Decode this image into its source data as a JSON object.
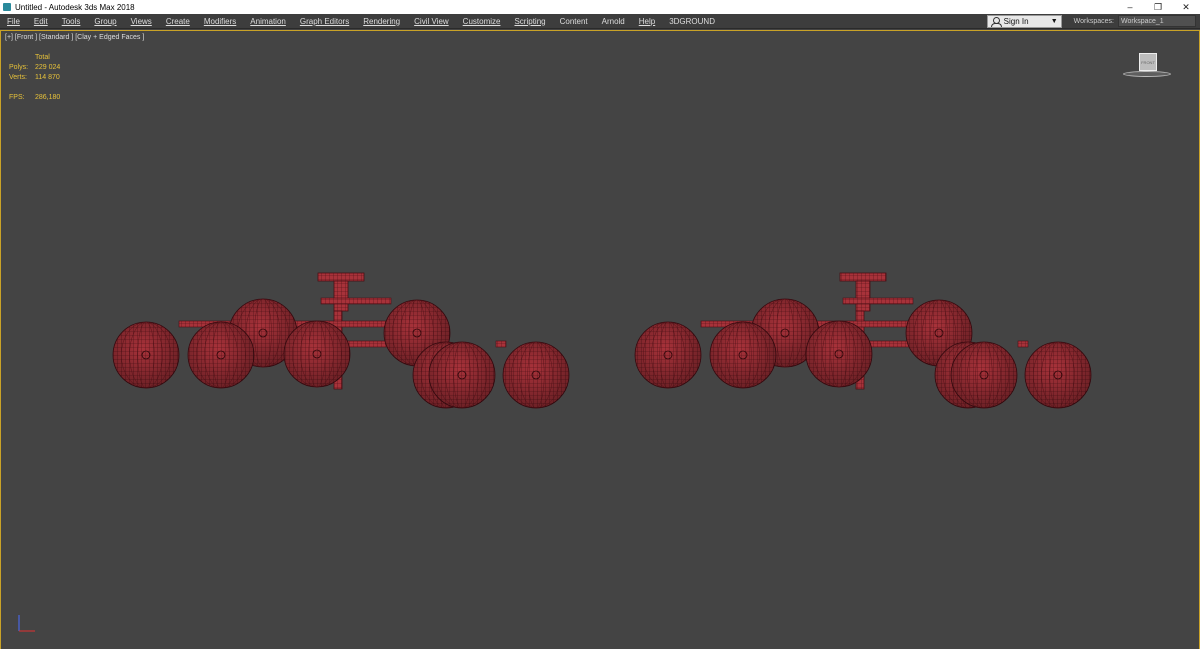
{
  "window": {
    "title": "Untitled - Autodesk 3ds Max 2018",
    "controls": [
      "–",
      "❐",
      "✕"
    ]
  },
  "menu": {
    "items": [
      "File",
      "Edit",
      "Tools",
      "Group",
      "Views",
      "Create",
      "Modifiers",
      "Animation",
      "Graph Editors",
      "Rendering",
      "Civil View",
      "Customize",
      "Scripting",
      "Content",
      "Arnold",
      "Help",
      "3DGROUND"
    ]
  },
  "signin": {
    "label": "Sign In",
    "icon": "user-icon"
  },
  "workspaces": {
    "label": "Workspaces:",
    "value": "Workspace_1"
  },
  "viewport": {
    "label": "[+] [Front ] [Standard ] [Clay + Edged Faces ]",
    "stats": {
      "header": "Total",
      "polys_label": "Polys:",
      "polys": "229 024",
      "verts_label": "Verts:",
      "verts": "114 870",
      "fps_label": "FPS:",
      "fps": "286,180"
    },
    "viewcube_text": "FRONT"
  },
  "colors": {
    "accent_border": "#c9a227",
    "stats_text": "#e7c23a",
    "mesh_fill": "#a8323a",
    "mesh_wire": "#4a0e14",
    "viewport_bg": "#444444"
  }
}
